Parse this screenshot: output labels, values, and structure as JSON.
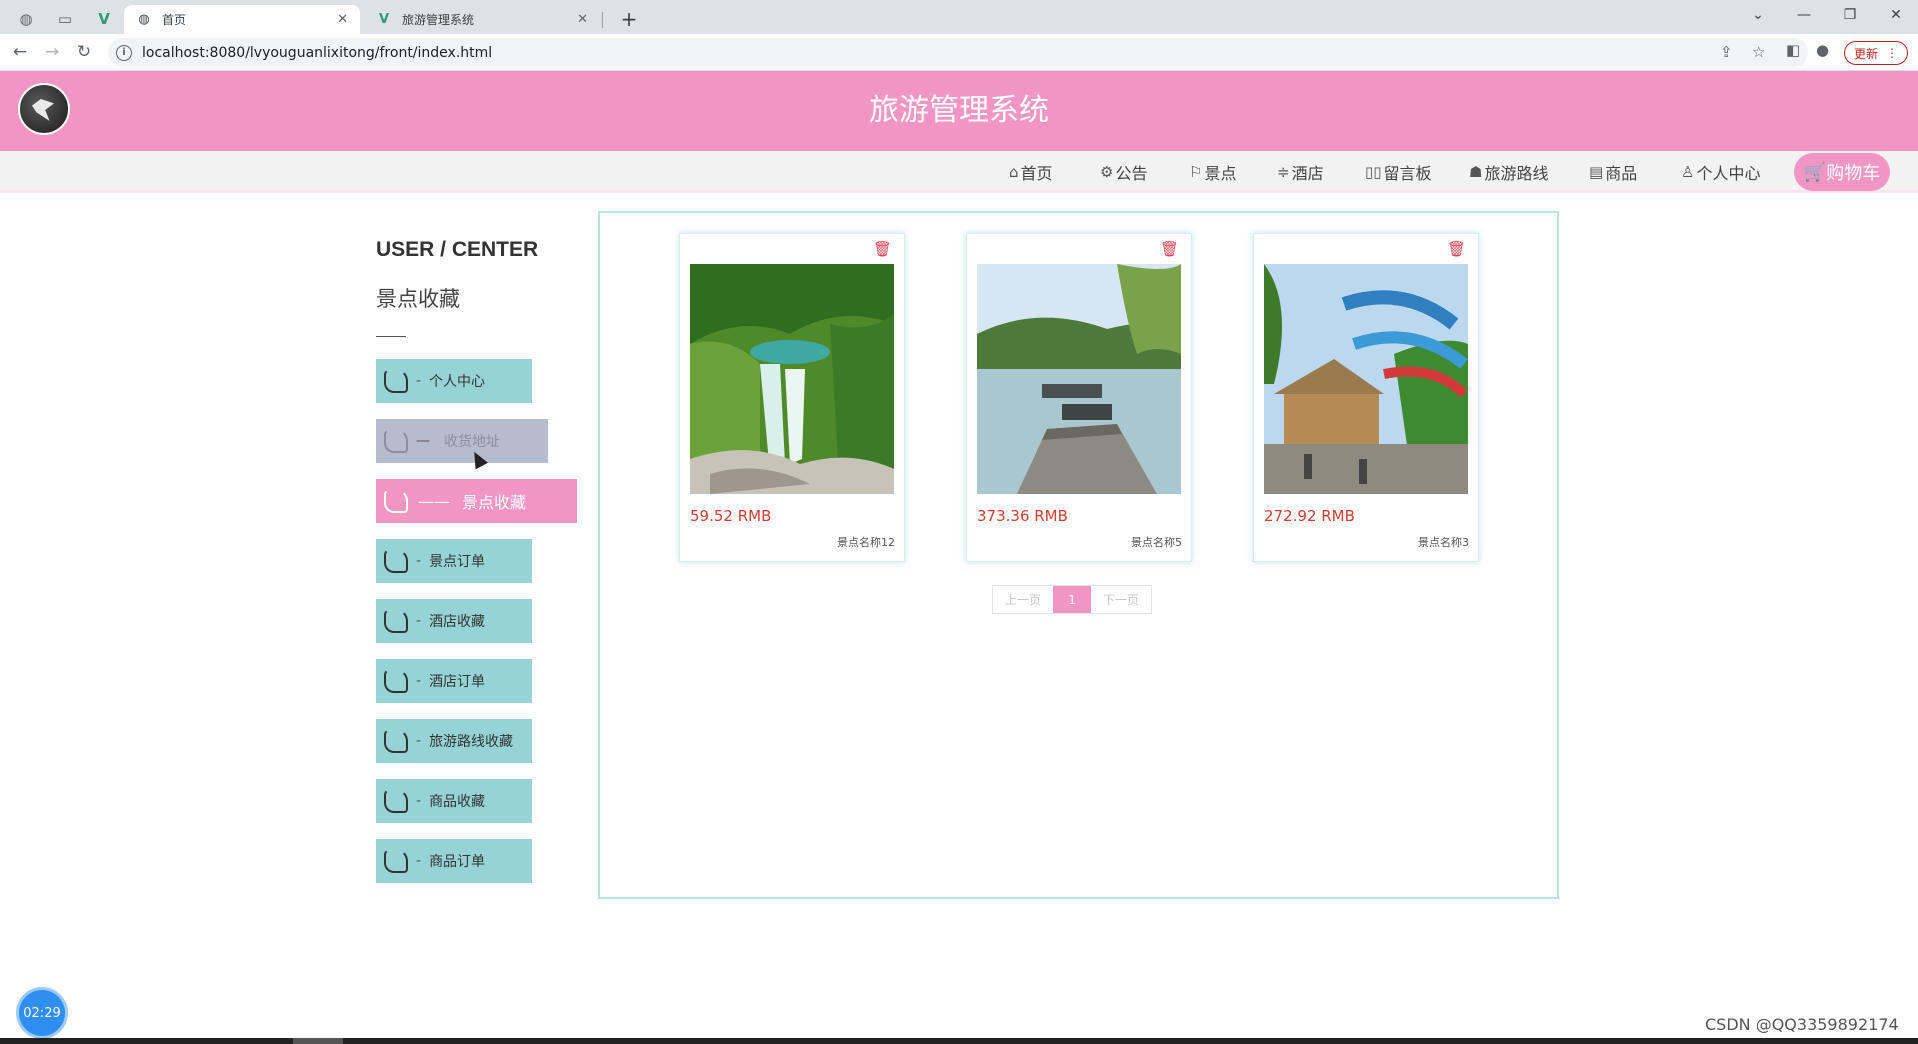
{
  "browser": {
    "tabs": [
      {
        "title": "首页",
        "active": true
      },
      {
        "title": "旅游管理系统",
        "active": false
      }
    ],
    "url": "localhost:8080/lvyouguanlixitong/front/index.html",
    "update_label": "更新"
  },
  "site": {
    "title": "旅游管理系统",
    "nav": [
      {
        "icon": "home-icon",
        "label": "首页"
      },
      {
        "icon": "gear-icon",
        "label": "公告"
      },
      {
        "icon": "flag-icon",
        "label": "景点"
      },
      {
        "icon": "sliders-icon",
        "label": "酒店"
      },
      {
        "icon": "book-icon",
        "label": "留言板"
      },
      {
        "icon": "graduation-cap-icon",
        "label": "旅游路线"
      },
      {
        "icon": "document-icon",
        "label": "商品"
      },
      {
        "icon": "user-icon",
        "label": "个人中心"
      }
    ],
    "cart_label": "购物车"
  },
  "sidebar": {
    "title": "USER / CENTER",
    "subtitle": "景点收藏",
    "items": [
      {
        "label": "个人中心",
        "state": "normal"
      },
      {
        "label": "收货地址",
        "state": "hover"
      },
      {
        "label": "景点收藏",
        "state": "active"
      },
      {
        "label": "景点订单",
        "state": "normal"
      },
      {
        "label": "酒店收藏",
        "state": "normal"
      },
      {
        "label": "酒店订单",
        "state": "normal"
      },
      {
        "label": "旅游路线收藏",
        "state": "normal"
      },
      {
        "label": "商品收藏",
        "state": "normal"
      },
      {
        "label": "商品订单",
        "state": "normal"
      }
    ]
  },
  "favorites": [
    {
      "price": "59.52 RMB",
      "name": "景点名称12"
    },
    {
      "price": "373.36 RMB",
      "name": "景点名称5"
    },
    {
      "price": "272.92 RMB",
      "name": "景点名称3"
    }
  ],
  "pager": {
    "prev": "上一页",
    "current": "1",
    "next": "下一页"
  },
  "timer": "02:29",
  "watermark": "CSDN @QQ3359892174",
  "colors": {
    "accent_pink": "#f095c4",
    "menu_teal": "#96d3d6",
    "price_red": "#d63b2f"
  }
}
